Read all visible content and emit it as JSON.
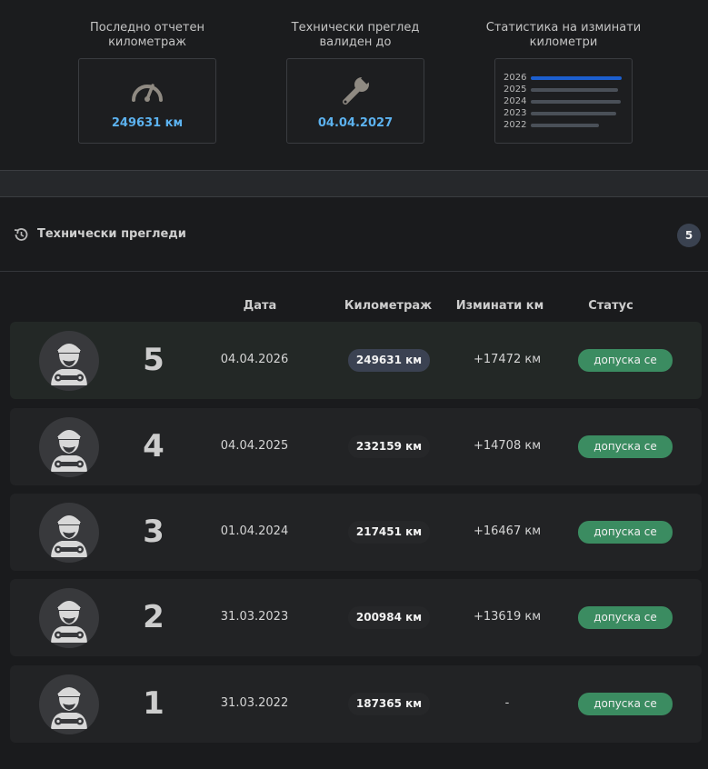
{
  "summary": {
    "mileage": {
      "title": "Последно отчетен километраж",
      "value": "249631 км",
      "icon": "speedometer-icon"
    },
    "inspection": {
      "title": "Технически преглед валиден до",
      "value": "04.04.2027",
      "icon": "wrench-icon"
    },
    "stats": {
      "title": "Статистика на изминати километри",
      "rows": [
        {
          "year": "2026",
          "value": 17472
        },
        {
          "year": "2025",
          "value": 14708
        },
        {
          "year": "2024",
          "value": 16467
        },
        {
          "year": "2023",
          "value": 13619
        },
        {
          "year": "2022",
          "value": 0
        }
      ],
      "highlight_color": "#1c5fcf",
      "bar_color": "#4a5058"
    }
  },
  "section": {
    "title": "Технически прегледи",
    "count": "5",
    "icon": "history-icon"
  },
  "table": {
    "headers": {
      "date": "Дата",
      "mileage": "Километраж",
      "diff": "Изминати км",
      "status": "Статус"
    },
    "rows": [
      {
        "num": "5",
        "date": "04.04.2026",
        "km": "249631 км",
        "diff": "+17472 км",
        "status": "допуска се"
      },
      {
        "num": "4",
        "date": "04.04.2025",
        "km": "232159 км",
        "diff": "+14708 км",
        "status": "допуска се"
      },
      {
        "num": "3",
        "date": "01.04.2024",
        "km": "217451 км",
        "diff": "+16467 км",
        "status": "допуска се"
      },
      {
        "num": "2",
        "date": "31.03.2023",
        "km": "200984 км",
        "diff": "+13619 км",
        "status": "допуска се"
      },
      {
        "num": "1",
        "date": "31.03.2022",
        "km": "187365 км",
        "diff": "-",
        "status": "допуска се"
      }
    ]
  },
  "colors": {
    "accent": "#5cb2ef",
    "status_ok": "#3b8c61"
  }
}
